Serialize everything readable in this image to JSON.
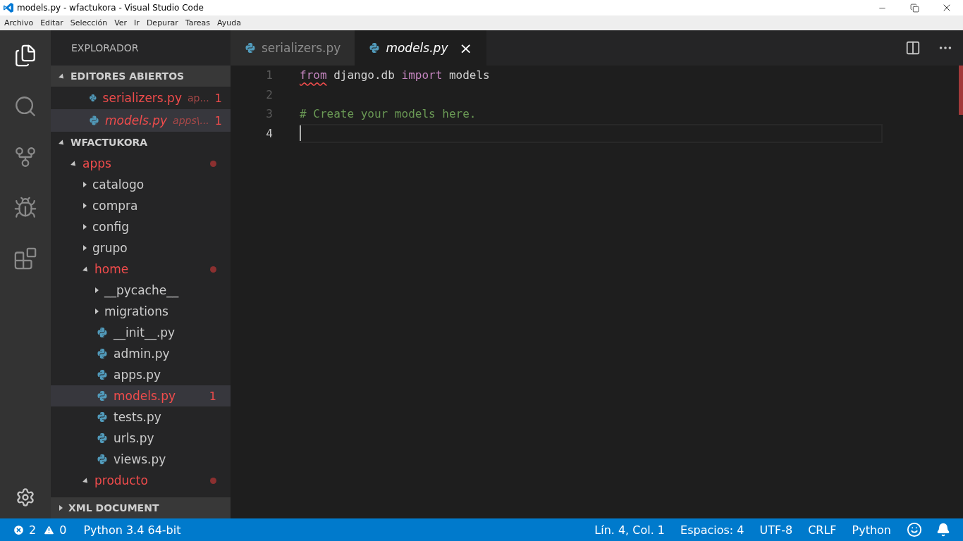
{
  "window": {
    "title": "models.py - wfactukora - Visual Studio Code"
  },
  "menu": [
    "Archivo",
    "Editar",
    "Selección",
    "Ver",
    "Ir",
    "Depurar",
    "Tareas",
    "Ayuda"
  ],
  "activity_bar": [
    {
      "kind": "files",
      "selected": true
    },
    {
      "kind": "search",
      "selected": false
    },
    {
      "kind": "git",
      "selected": false
    },
    {
      "kind": "debug",
      "selected": false
    },
    {
      "kind": "extensions",
      "selected": false
    }
  ],
  "sidebar": {
    "title": "EXPLORADOR",
    "open_editors": {
      "title": "EDITORES ABIERTOS",
      "expanded": true,
      "items": [
        {
          "name": "serializers.py",
          "path": "ap...",
          "problems": "1",
          "preview": false,
          "selected": false
        },
        {
          "name": "models.py",
          "path": "apps\\...",
          "problems": "1",
          "preview": true,
          "selected": true
        }
      ]
    },
    "project": {
      "title": "WFACTUKORA",
      "expanded": true,
      "tree": [
        {
          "name": "apps",
          "kind": "folder",
          "expanded": true,
          "error": true,
          "modified": true,
          "selected": false,
          "children": [
            {
              "name": "catalogo",
              "kind": "folder",
              "expanded": false,
              "error": false,
              "modified": false,
              "selected": false
            },
            {
              "name": "compra",
              "kind": "folder",
              "expanded": false,
              "error": false,
              "modified": false,
              "selected": false
            },
            {
              "name": "config",
              "kind": "folder",
              "expanded": false,
              "error": false,
              "modified": false,
              "selected": false
            },
            {
              "name": "grupo",
              "kind": "folder",
              "expanded": false,
              "error": false,
              "modified": false,
              "selected": false
            },
            {
              "name": "home",
              "kind": "folder",
              "expanded": true,
              "error": true,
              "modified": true,
              "selected": false,
              "children": [
                {
                  "name": "__pycache__",
                  "kind": "folder",
                  "expanded": false,
                  "error": false,
                  "modified": false,
                  "selected": false
                },
                {
                  "name": "migrations",
                  "kind": "folder",
                  "expanded": false,
                  "error": false,
                  "modified": false,
                  "selected": false
                },
                {
                  "name": "__init__.py",
                  "kind": "file",
                  "error": false,
                  "modified": false,
                  "selected": false
                },
                {
                  "name": "admin.py",
                  "kind": "file",
                  "error": false,
                  "modified": false,
                  "selected": false
                },
                {
                  "name": "apps.py",
                  "kind": "file",
                  "error": false,
                  "modified": false,
                  "selected": false
                },
                {
                  "name": "models.py",
                  "kind": "file",
                  "error": true,
                  "modified": false,
                  "problems": "1",
                  "selected": true
                },
                {
                  "name": "tests.py",
                  "kind": "file",
                  "error": false,
                  "modified": false,
                  "selected": false
                },
                {
                  "name": "urls.py",
                  "kind": "file",
                  "error": false,
                  "modified": false,
                  "selected": false
                },
                {
                  "name": "views.py",
                  "kind": "file",
                  "error": false,
                  "modified": false,
                  "selected": false
                }
              ]
            },
            {
              "name": "producto",
              "kind": "folder",
              "expanded": true,
              "error": true,
              "modified": true,
              "selected": false
            }
          ]
        }
      ]
    },
    "xml_section": {
      "title": "XML DOCUMENT",
      "expanded": false
    }
  },
  "tabs": [
    {
      "label": "serializers.py",
      "selected": false,
      "preview": false
    },
    {
      "label": "models.py",
      "selected": true,
      "preview": true,
      "close": "×"
    }
  ],
  "editor": {
    "lines": [
      {
        "number": "1",
        "current": false,
        "tokens": [
          {
            "text": "from",
            "kind": "keyword",
            "error": true
          },
          {
            "text": " django.db ",
            "kind": "plain"
          },
          {
            "text": "import",
            "kind": "keyword"
          },
          {
            "text": " models",
            "kind": "plain"
          }
        ]
      },
      {
        "number": "2",
        "current": false
      },
      {
        "number": "3",
        "current": false,
        "tokens": [
          {
            "text": "# Create your models here.",
            "kind": "comment"
          }
        ]
      },
      {
        "number": "4",
        "current": true
      }
    ]
  },
  "status_bar": {
    "errors": "2",
    "warnings": "0",
    "interpreter": "Python 3.4 64-bit",
    "right": [
      "Lín. 4, Col. 1",
      "Espacios: 4",
      "UTF-8",
      "CRLF",
      "Python"
    ]
  }
}
